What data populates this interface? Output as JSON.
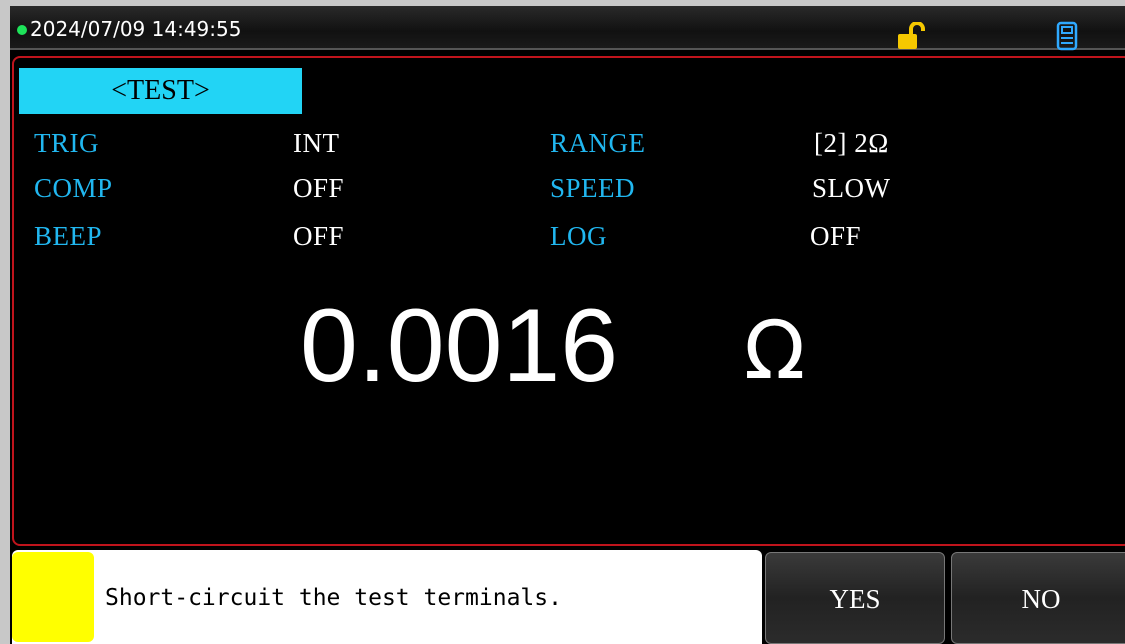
{
  "status_bar": {
    "datetime": "2024/07/09 14:49:55",
    "status_dot_color": "#1ee35a",
    "icons": [
      "unlocked-padlock-icon",
      "usb-storage-icon"
    ]
  },
  "page": {
    "title": "<TEST>"
  },
  "settings": {
    "trig": {
      "label": "TRIG",
      "value": "INT"
    },
    "comp": {
      "label": "COMP",
      "value": "OFF"
    },
    "beep": {
      "label": "BEEP",
      "value": "OFF"
    },
    "range": {
      "label": "RANGE",
      "value": "[2] 2Ω"
    },
    "speed": {
      "label": "SPEED",
      "value": "SLOW"
    },
    "log": {
      "label": "LOG",
      "value": "OFF"
    }
  },
  "measurement": {
    "value": "0.0016",
    "unit": "Ω"
  },
  "message": {
    "text": "Short-circuit the test terminals.",
    "indicator_color": "#ffff00"
  },
  "softkeys": {
    "yes": "YES",
    "no": "NO"
  },
  "colors": {
    "label": "#21b7f0",
    "value": "#ffffff",
    "tab": "#22d4f5",
    "panel_border": "#c0141c"
  }
}
